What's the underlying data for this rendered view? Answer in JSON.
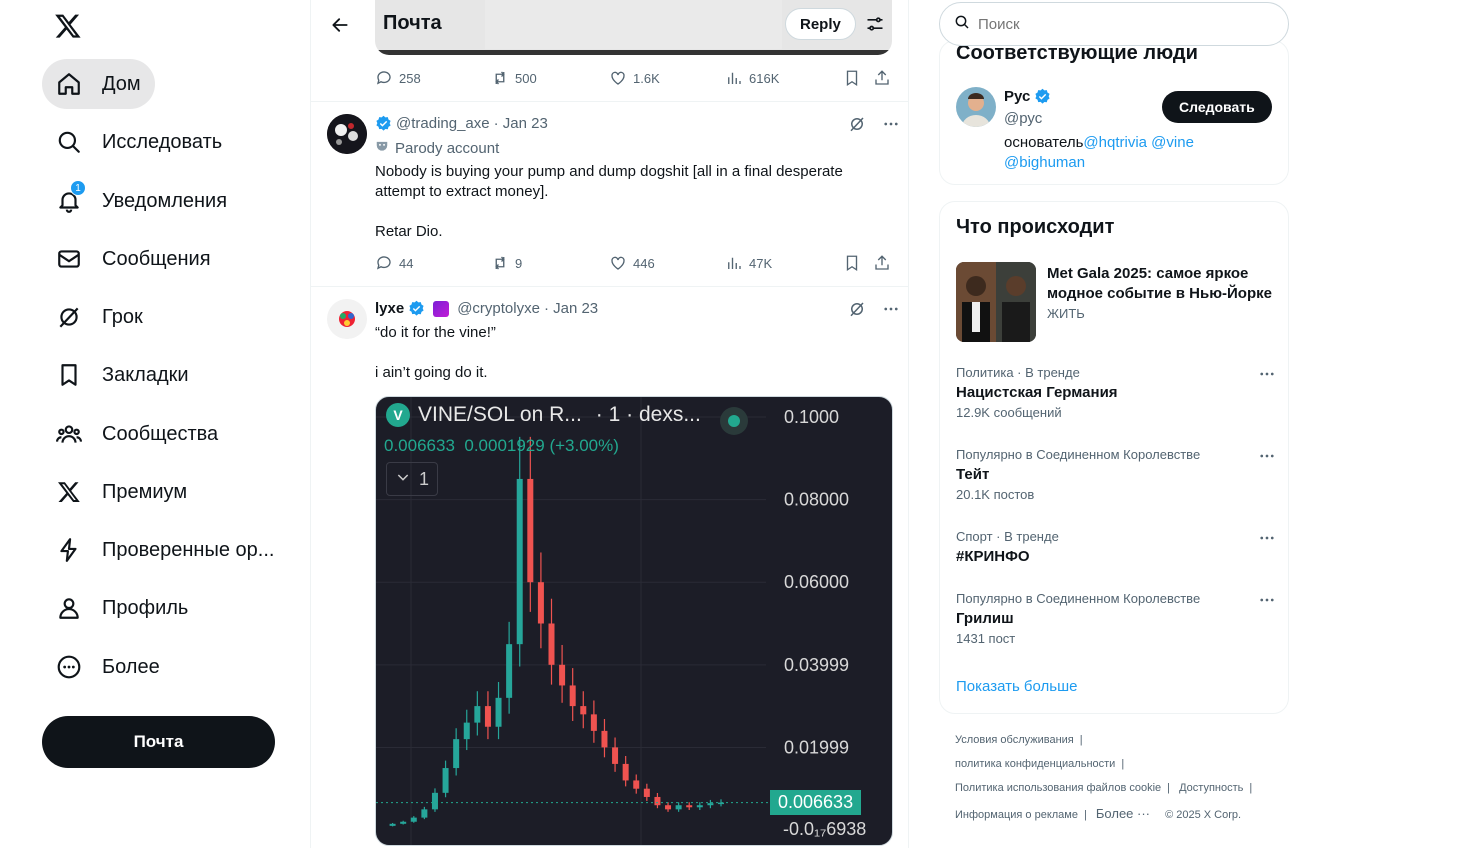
{
  "nav": {
    "items": [
      {
        "label": "Дом",
        "icon": "home-icon"
      },
      {
        "label": "Исследовать",
        "icon": "search-icon"
      },
      {
        "label": "Уведомления",
        "icon": "bell-icon",
        "badge": "1"
      },
      {
        "label": "Сообщения",
        "icon": "mail-icon"
      },
      {
        "label": "Грок",
        "icon": "grok-icon"
      },
      {
        "label": "Закладки",
        "icon": "bookmark-icon"
      },
      {
        "label": "Сообщества",
        "icon": "communities-icon"
      },
      {
        "label": "Премиум",
        "icon": "x-premium-icon"
      },
      {
        "label": "Проверенные ор...",
        "icon": "lightning-icon"
      },
      {
        "label": "Профиль",
        "icon": "person-icon"
      },
      {
        "label": "Более",
        "icon": "more-circle-icon"
      }
    ],
    "post_button": "Почта"
  },
  "header": {
    "title": "Почта",
    "reply_button": "Reply"
  },
  "top_tweet_actions": {
    "replies": "258",
    "reposts": "500",
    "likes": "1.6K",
    "views": "616K"
  },
  "tweets": [
    {
      "handle": "@trading_axe",
      "date": "· Jan 23",
      "parody_label": "Parody account",
      "body_line1": "Nobody is buying your pump and dump dogshit [all in a final desperate",
      "body_line2": "attempt to extract money].",
      "body_line3": "Retar Dio.",
      "replies": "44",
      "reposts": "9",
      "likes": "446",
      "views": "47K"
    },
    {
      "name": "lyxe",
      "handle": "@cryptolyxe",
      "date": "· Jan 23",
      "body_line1": "“do it for the vine!”",
      "body_line2": "i ain’t going do it."
    }
  ],
  "chart_card": {
    "title": "VINE/SOL on R...",
    "title_suffix": "· 1 · dexs...",
    "price_line": "0.006633",
    "change_line": "0.0001929 (+3.00%)",
    "interval": "1",
    "current_price_label": "0.006633",
    "bottom_label": "-0.0₁₇6938",
    "colors": {
      "bg": "#1c1d27",
      "up": "#26a69a",
      "down": "#ef5350",
      "accent": "#22a88f"
    }
  },
  "chart_data": {
    "type": "line",
    "title": "VINE/SOL on R...",
    "y_tick_labels": [
      "0.1000",
      "0.08000",
      "0.06000",
      "0.03999",
      "0.01999"
    ],
    "ylim": [
      0,
      0.1
    ],
    "series": [
      {
        "values": [
          0.001,
          0.0015,
          0.002,
          0.003,
          0.005,
          0.009,
          0.015,
          0.022,
          0.026,
          0.03,
          0.025,
          0.032,
          0.045,
          0.085,
          0.06,
          0.05,
          0.04,
          0.035,
          0.03,
          0.028,
          0.024,
          0.02,
          0.016,
          0.012,
          0.01,
          0.008,
          0.006,
          0.005,
          0.006,
          0.0055,
          0.006,
          0.0065,
          0.006633
        ]
      }
    ],
    "current_value": 0.006633
  },
  "search": {
    "placeholder": "Поиск"
  },
  "who_to_follow": {
    "title": "Соответствующие люди",
    "name": "Рус",
    "handle": "@рус",
    "follow_button": "Следовать",
    "bio_prefix": "основатель",
    "bio_link1": "@hqtrivia",
    "bio_link2": "@vine",
    "bio_link3": "@bighuman"
  },
  "trending": {
    "title": "Что происходит",
    "featured": {
      "title_line1": "Met Gala 2025: самое яркое",
      "title_line2": "модное событие в Нью-Йорке",
      "status": "ЖИТЬ"
    },
    "items": [
      {
        "category": "Политика · В тренде",
        "name": "Нацистская Германия",
        "count": "12.9K сообщений"
      },
      {
        "category": "Популярно в Соединенном Королевстве",
        "name": "Тейт",
        "count": "20.1K постов"
      },
      {
        "category": "Спорт · В тренде",
        "name": "#КРИНФО",
        "count": ""
      },
      {
        "category": "Популярно в Соединенном Королевстве",
        "name": "Грилиш",
        "count": "1431 пост"
      }
    ],
    "show_more": "Показать больше"
  },
  "footer": {
    "terms": "Условия обслуживания",
    "privacy": "политика конфиденциальности",
    "cookies": "Политика использования файлов cookie",
    "accessibility": "Доступность",
    "ads": "Информация о рекламе",
    "more": "Более ···",
    "copyright": "© 2025 X Corp."
  }
}
